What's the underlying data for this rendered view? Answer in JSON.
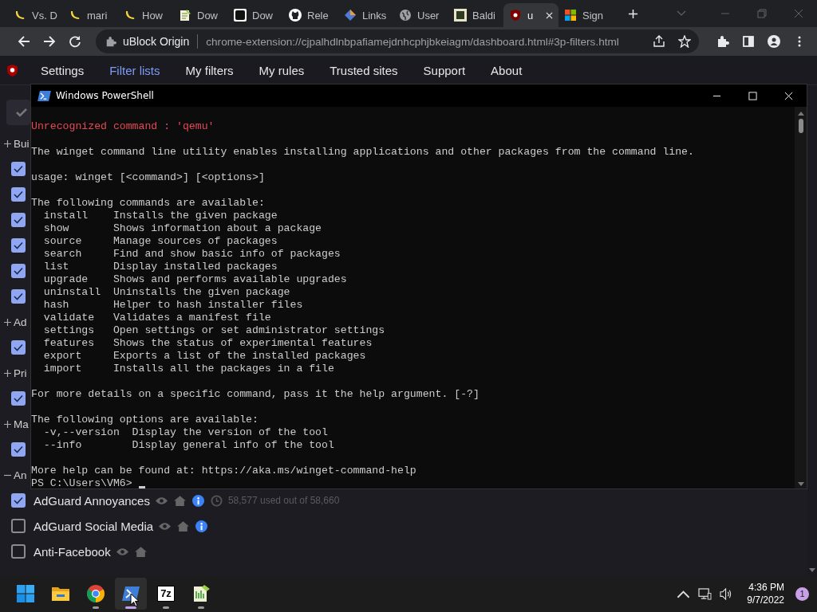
{
  "browser": {
    "tabs": [
      {
        "title": "Vs. D",
        "kind": "banana",
        "selected": false
      },
      {
        "title": "mari",
        "kind": "banana",
        "selected": false
      },
      {
        "title": "How",
        "kind": "banana",
        "selected": false
      },
      {
        "title": "Dow",
        "kind": "notepad",
        "selected": false
      },
      {
        "title": "Dow",
        "kind": "dot",
        "selected": false
      },
      {
        "title": "Rele",
        "kind": "github",
        "selected": false
      },
      {
        "title": "Links",
        "kind": "links",
        "selected": false
      },
      {
        "title": "User",
        "kind": "globe",
        "selected": false
      },
      {
        "title": "Baldi",
        "kind": "picture",
        "selected": false
      },
      {
        "title": "u",
        "kind": "ublock",
        "selected": true
      },
      {
        "title": "Sign",
        "kind": "microsoft",
        "selected": false
      }
    ],
    "omnibox": {
      "site": "uBlock Origin",
      "url": "chrome-extension://cjpalhdlnbpafiamejdnhcphjbkeiagm/dashboard.html#3p-filters.html"
    }
  },
  "nav": [
    {
      "label": "Settings",
      "selected": false
    },
    {
      "label": "Filter lists",
      "selected": true
    },
    {
      "label": "My filters",
      "selected": false
    },
    {
      "label": "My rules",
      "selected": false
    },
    {
      "label": "Trusted sites",
      "selected": false
    },
    {
      "label": "Support",
      "selected": false
    },
    {
      "label": "About",
      "selected": false
    }
  ],
  "sections": [
    {
      "label": "Bui",
      "expanded": false,
      "items": [
        {
          "checked": true
        },
        {
          "checked": true
        },
        {
          "checked": true
        },
        {
          "checked": true
        },
        {
          "checked": true
        },
        {
          "checked": true
        }
      ]
    },
    {
      "label": "Ad",
      "expanded": false,
      "items": [
        {
          "checked": true
        }
      ]
    },
    {
      "label": "Pri",
      "expanded": false,
      "items": [
        {
          "checked": true
        }
      ]
    },
    {
      "label": "Ma",
      "expanded": false,
      "items": [
        {
          "checked": true
        }
      ]
    },
    {
      "label": "An",
      "expanded": true,
      "items": [
        {
          "checked": true,
          "name": "AdGuard Annoyances",
          "info": true,
          "stats": "58,577 used out of 58,660"
        },
        {
          "checked": false,
          "name": "AdGuard Social Media",
          "info": true
        },
        {
          "checked": false,
          "name": "Anti-Facebook",
          "info": false
        }
      ]
    }
  ],
  "powershell": {
    "title": "Windows PowerShell",
    "blocks": [
      {
        "kind": "error",
        "lines": [
          "Unrecognized command : 'qemu'"
        ]
      },
      {
        "kind": "output",
        "lines": [
          "The winget command line utility enables installing applications and other packages from the command line."
        ]
      },
      {
        "kind": "output",
        "lines": [
          "usage: winget [<command>] [<options>]"
        ]
      },
      {
        "kind": "output",
        "lines": [
          "The following commands are available:",
          "  install    Installs the given package",
          "  show       Shows information about a package",
          "  source     Manage sources of packages",
          "  search     Find and show basic info of packages",
          "  list       Display installed packages",
          "  upgrade    Shows and performs available upgrades",
          "  uninstall  Uninstalls the given package",
          "  hash       Helper to hash installer files",
          "  validate   Validates a manifest file",
          "  settings   Open settings or set administrator settings",
          "  features   Shows the status of experimental features",
          "  export     Exports a list of the installed packages",
          "  import     Installs all the packages in a file"
        ]
      },
      {
        "kind": "output",
        "lines": [
          "For more details on a specific command, pass it the help argument. [-?]"
        ]
      },
      {
        "kind": "output",
        "lines": [
          "The following options are available:",
          "  -v,--version  Display the version of the tool",
          "  --info        Display general info of the tool"
        ]
      },
      {
        "kind": "output",
        "lines": [
          "More help can be found at: https://aka.ms/winget-command-help"
        ]
      }
    ],
    "prompt": "PS C:\\Users\\VM6>"
  },
  "taskbar": {
    "apps": [
      {
        "kind": "start",
        "running": false,
        "selected": false
      },
      {
        "kind": "explorer",
        "running": false,
        "selected": false
      },
      {
        "kind": "chrome",
        "running": true,
        "selected": false
      },
      {
        "kind": "powershell",
        "running": true,
        "selected": true
      },
      {
        "kind": "sevenzip",
        "label": "7z",
        "running": true,
        "selected": false
      },
      {
        "kind": "notepad",
        "running": true,
        "selected": false
      }
    ],
    "time": "4:36 PM",
    "date": "9/7/2022",
    "notifications": "1"
  }
}
